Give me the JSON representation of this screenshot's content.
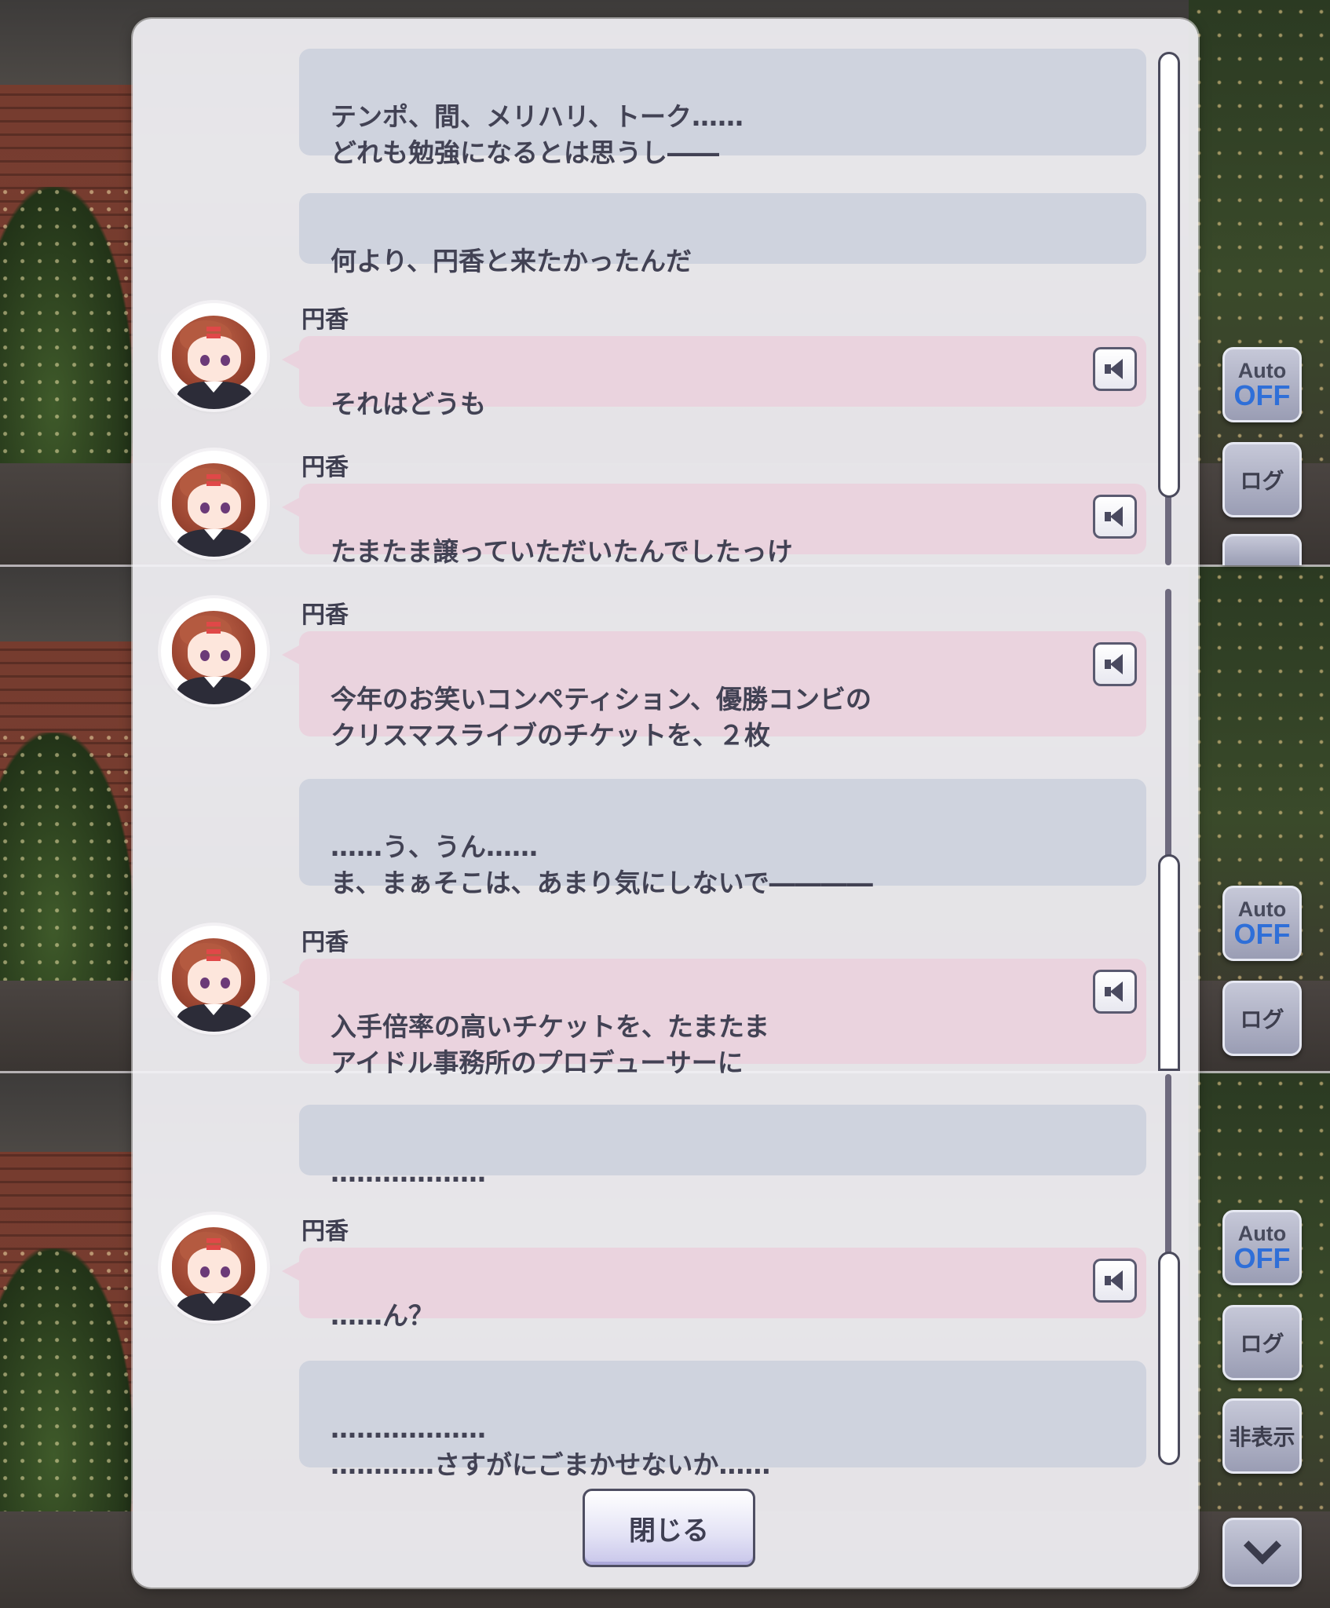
{
  "controls": {
    "auto_top": "Auto",
    "auto_bottom": "OFF",
    "log": "ログ",
    "hide": "非表示"
  },
  "messages": [
    {
      "speaker": "",
      "text": "テンポ、間、メリハリ、トーク……\nどれも勉強になるとは思うし――"
    },
    {
      "speaker": "",
      "text": "何より、円香と来たかったんだ"
    },
    {
      "speaker": "円香",
      "text": "それはどうも"
    },
    {
      "speaker": "円香",
      "text": "たまたま譲っていただいたんでしたっけ"
    },
    {
      "speaker": "円香",
      "text": "今年のお笑いコンペティション、優勝コンビの\nクリスマスライブのチケットを、２枚"
    },
    {
      "speaker": "",
      "text": "……う、うん……\nま、まぁそこは、あまり気にしないで――――"
    },
    {
      "speaker": "円香",
      "text": "入手倍率の高いチケットを、たまたま\nアイドル事務所のプロデューサーに"
    },
    {
      "speaker": "",
      "text": "………………"
    },
    {
      "speaker": "円香",
      "text": "……ん？"
    },
    {
      "speaker": "",
      "text": "………………\n…………さすがにごまかせないか……"
    }
  ],
  "close_button": "閉じる"
}
